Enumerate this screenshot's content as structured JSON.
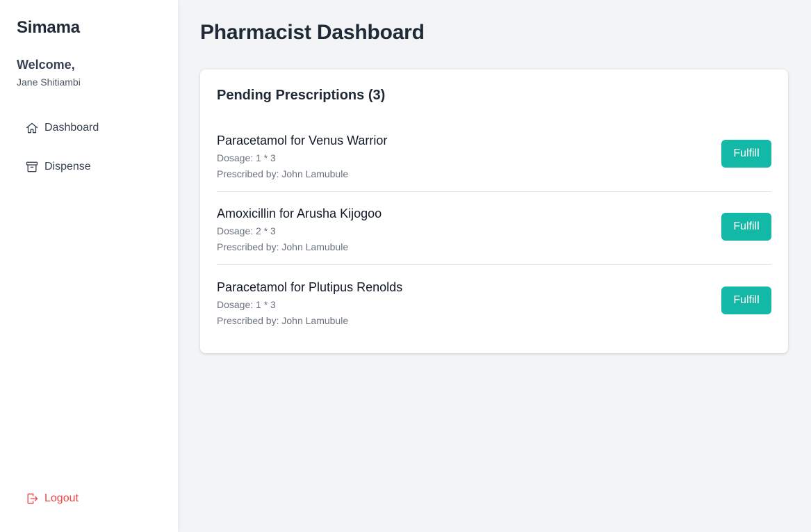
{
  "sidebar": {
    "brand": "Simama",
    "welcome": "Welcome,",
    "username": "Jane Shitiambi",
    "items": [
      {
        "label": "Dashboard",
        "icon": "home-icon"
      },
      {
        "label": "Dispense",
        "icon": "archive-icon"
      }
    ],
    "logout_label": "Logout",
    "logout_icon": "logout-icon"
  },
  "main": {
    "title": "Pharmacist Dashboard",
    "card": {
      "title": "Pending Prescriptions (3)",
      "prescriptions": [
        {
          "title": "Paracetamol for Venus Warrior",
          "dosage": "Dosage: 1 * 3",
          "prescriber": "Prescribed by: John Lamubule",
          "action": "Fulfill"
        },
        {
          "title": "Amoxicillin for Arusha Kijogoo",
          "dosage": "Dosage: 2 * 3",
          "prescriber": "Prescribed by: John Lamubule",
          "action": "Fulfill"
        },
        {
          "title": "Paracetamol for Plutipus Renolds",
          "dosage": "Dosage: 1 * 3",
          "prescriber": "Prescribed by: John Lamubule",
          "action": "Fulfill"
        }
      ]
    }
  },
  "colors": {
    "accent": "#14b8a6",
    "danger": "#ef4444",
    "background": "#f3f4f6",
    "surface": "#ffffff",
    "text": "#1f2937",
    "muted": "#6b7280"
  }
}
